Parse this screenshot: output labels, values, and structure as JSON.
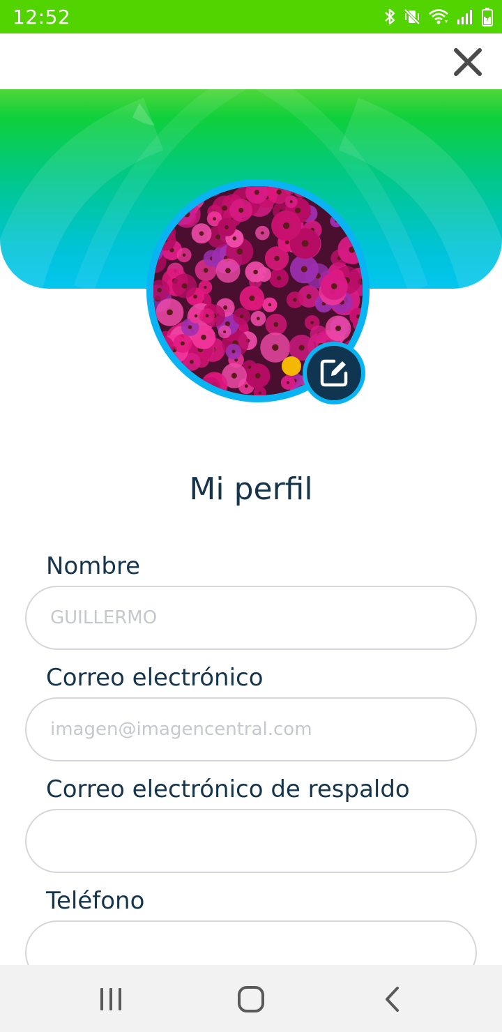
{
  "status_bar": {
    "time": "12:52",
    "icons": [
      "bluetooth-icon",
      "mute-vibrate-icon",
      "wifi-icon",
      "signal-icon",
      "battery-charging-icon"
    ],
    "background": "#52d400"
  },
  "top_bar": {
    "close_icon": "close-icon"
  },
  "header": {
    "gradient_colors": [
      "#4fd63a",
      "#0fd03b",
      "#00c88a",
      "#04c5ef"
    ],
    "avatar_ring_color": "#0ab4f2",
    "edit_icon": "edit-icon"
  },
  "profile": {
    "title": "Mi perfil"
  },
  "form": {
    "fields": [
      {
        "label": "Nombre",
        "value": "",
        "placeholder": "GUILLERMO"
      },
      {
        "label": "Correo electrónico",
        "value": "",
        "placeholder": "imagen@imagencentral.com"
      },
      {
        "label": "Correo electrónico de respaldo",
        "value": "",
        "placeholder": ""
      },
      {
        "label": "Teléfono",
        "value": "",
        "placeholder": ""
      }
    ]
  },
  "nav_bar": {
    "buttons": [
      "recent-apps-icon",
      "home-icon",
      "back-icon"
    ]
  }
}
